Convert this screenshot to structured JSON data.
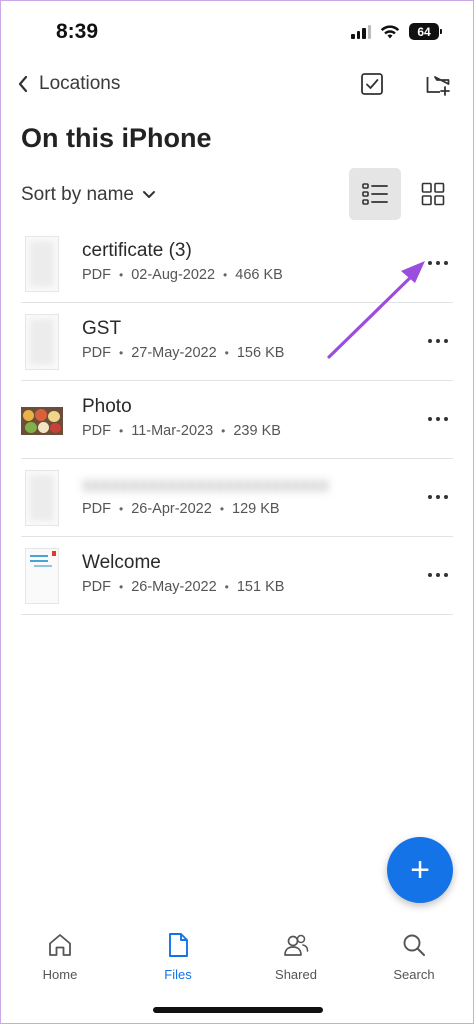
{
  "status_bar": {
    "time": "8:39",
    "battery": "64",
    "icons": [
      "signal-icon",
      "wifi-icon",
      "battery-icon"
    ]
  },
  "nav": {
    "back_label": "Locations",
    "actions": [
      "select-checkbox-icon",
      "new-folder-icon"
    ]
  },
  "page": {
    "title": "On this iPhone"
  },
  "sort": {
    "label": "Sort by name",
    "view_modes": [
      "list-view-icon",
      "grid-view-icon"
    ],
    "active_view": "list"
  },
  "files": [
    {
      "name": "certificate (3)",
      "type": "PDF",
      "date": "02-Aug-2022",
      "size": "466 KB",
      "thumb": "blurred-document"
    },
    {
      "name": "GST",
      "type": "PDF",
      "date": "27-May-2022",
      "size": "156 KB",
      "thumb": "blurred-document"
    },
    {
      "name": "Photo",
      "type": "PDF",
      "date": "11-Mar-2023",
      "size": "239 KB",
      "thumb": "food-photo"
    },
    {
      "name": "",
      "type": "PDF",
      "date": "26-Apr-2022",
      "size": "129 KB",
      "thumb": "blurred-document"
    },
    {
      "name": "Welcome",
      "type": "PDF",
      "date": "26-May-2022",
      "size": "151 KB",
      "thumb": "welcome-document"
    }
  ],
  "fab": {
    "label": "+"
  },
  "tabs": [
    {
      "label": "Home",
      "icon": "home-icon",
      "active": false
    },
    {
      "label": "Files",
      "icon": "file-icon",
      "active": true
    },
    {
      "label": "Shared",
      "icon": "people-icon",
      "active": false
    },
    {
      "label": "Search",
      "icon": "search-icon",
      "active": false
    }
  ],
  "colors": {
    "accent": "#1473e6",
    "annotation": "#9b4dde"
  }
}
